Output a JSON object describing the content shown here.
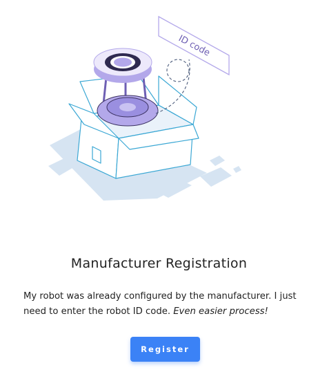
{
  "illustration": {
    "id_card_label": "ID code"
  },
  "heading": "Manufacturer Registration",
  "description": {
    "text": "My robot was already configured by the manufacturer. I just need to enter the robot ID code.",
    "emphasis": "Even easier process!"
  },
  "register_button": {
    "label": "Register"
  },
  "colors": {
    "accent": "#3b82f6",
    "shadow_blue": "#d6e4f2",
    "robot_purple": "#b3a8ea",
    "outline_blue": "#3aa7d4"
  }
}
